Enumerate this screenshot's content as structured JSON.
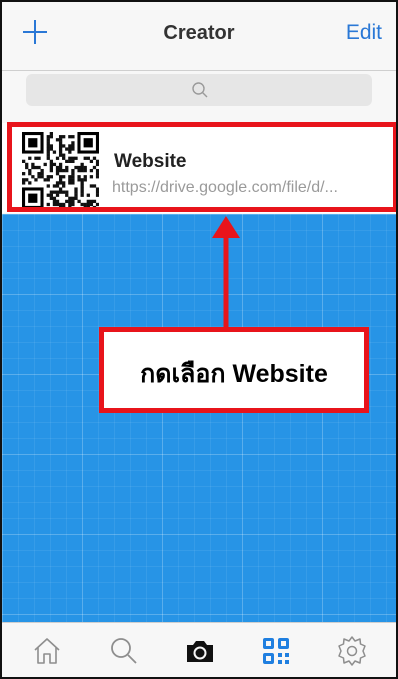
{
  "header": {
    "title": "Creator",
    "edit_label": "Edit",
    "add_icon": "plus-icon"
  },
  "search": {
    "icon": "search-icon",
    "placeholder": ""
  },
  "list": {
    "items": [
      {
        "name": "Website",
        "url": "https://drive.google.com/file/d/...",
        "thumbnail": "qr-code-icon"
      }
    ]
  },
  "annotation": {
    "callout_text": "กดเลือก Website",
    "color": "#e8141b"
  },
  "tabbar": {
    "items": [
      {
        "icon": "home-icon",
        "active": false
      },
      {
        "icon": "search-icon",
        "active": false
      },
      {
        "icon": "camera-icon",
        "active": false
      },
      {
        "icon": "qr-code-icon",
        "active": true
      },
      {
        "icon": "gear-icon",
        "active": false
      }
    ]
  },
  "colors": {
    "accent": "#2a78d6",
    "canvas_blue": "#2794e6",
    "annotation_red": "#e8141b"
  }
}
